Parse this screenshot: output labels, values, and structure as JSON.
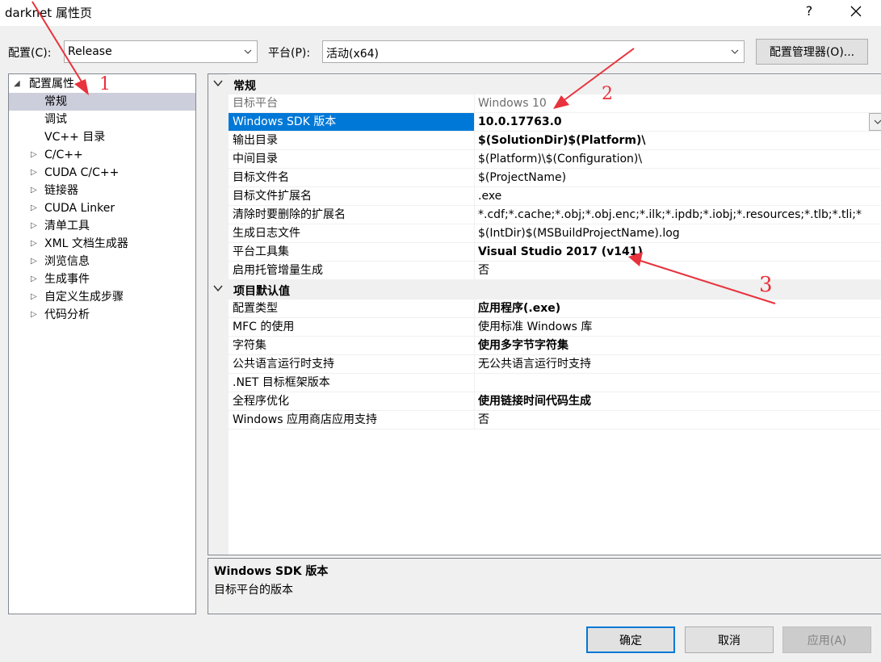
{
  "window": {
    "title": "darknet 属性页",
    "help": "?",
    "close_icon": "close-icon"
  },
  "toolbar": {
    "config_label": "配置(C):",
    "config_value": "Release",
    "platform_label": "平台(P):",
    "platform_value": "活动(x64)",
    "manager_button": "配置管理器(O)..."
  },
  "tree": {
    "root": "配置属性",
    "items": [
      {
        "label": "常规",
        "expandable": false,
        "selected": true
      },
      {
        "label": "调试",
        "expandable": false
      },
      {
        "label": "VC++ 目录",
        "expandable": false
      },
      {
        "label": "C/C++",
        "expandable": true
      },
      {
        "label": "CUDA C/C++",
        "expandable": true
      },
      {
        "label": "链接器",
        "expandable": true
      },
      {
        "label": "CUDA Linker",
        "expandable": true
      },
      {
        "label": "清单工具",
        "expandable": true
      },
      {
        "label": "XML 文档生成器",
        "expandable": true
      },
      {
        "label": "浏览信息",
        "expandable": true
      },
      {
        "label": "生成事件",
        "expandable": true
      },
      {
        "label": "自定义生成步骤",
        "expandable": true
      },
      {
        "label": "代码分析",
        "expandable": true
      }
    ]
  },
  "grid": {
    "categories": [
      {
        "label": "常规",
        "rows": [
          {
            "name": "目标平台",
            "value": "Windows 10",
            "readonly": true
          },
          {
            "name": "Windows SDK 版本",
            "value": "10.0.17763.0",
            "bold": true,
            "selected": true
          },
          {
            "name": "输出目录",
            "value": "$(SolutionDir)$(Platform)\\",
            "bold": true
          },
          {
            "name": "中间目录",
            "value": "$(Platform)\\$(Configuration)\\"
          },
          {
            "name": "目标文件名",
            "value": "$(ProjectName)"
          },
          {
            "name": "目标文件扩展名",
            "value": ".exe"
          },
          {
            "name": "清除时要删除的扩展名",
            "value": "*.cdf;*.cache;*.obj;*.obj.enc;*.ilk;*.ipdb;*.iobj;*.resources;*.tlb;*.tli;*"
          },
          {
            "name": "生成日志文件",
            "value": "$(IntDir)$(MSBuildProjectName).log"
          },
          {
            "name": "平台工具集",
            "value": "Visual Studio 2017 (v141)",
            "bold": true
          },
          {
            "name": "启用托管增量生成",
            "value": "否"
          }
        ]
      },
      {
        "label": "项目默认值",
        "rows": [
          {
            "name": "配置类型",
            "value": "应用程序(.exe)",
            "bold": true
          },
          {
            "name": "MFC 的使用",
            "value": "使用标准 Windows 库"
          },
          {
            "name": "字符集",
            "value": "使用多字节字符集",
            "bold": true
          },
          {
            "name": "公共语言运行时支持",
            "value": "无公共语言运行时支持"
          },
          {
            "name": ".NET 目标框架版本",
            "value": ""
          },
          {
            "name": "全程序优化",
            "value": "使用链接时间代码生成",
            "bold": true
          },
          {
            "name": "Windows 应用商店应用支持",
            "value": "否"
          }
        ]
      }
    ]
  },
  "description": {
    "title": "Windows SDK 版本",
    "text": "目标平台的版本"
  },
  "buttons": {
    "ok": "确定",
    "cancel": "取消",
    "apply": "应用(A)"
  },
  "annotations": {
    "n1": "1",
    "n2": "2",
    "n3": "3",
    "color": "#e8323c"
  }
}
